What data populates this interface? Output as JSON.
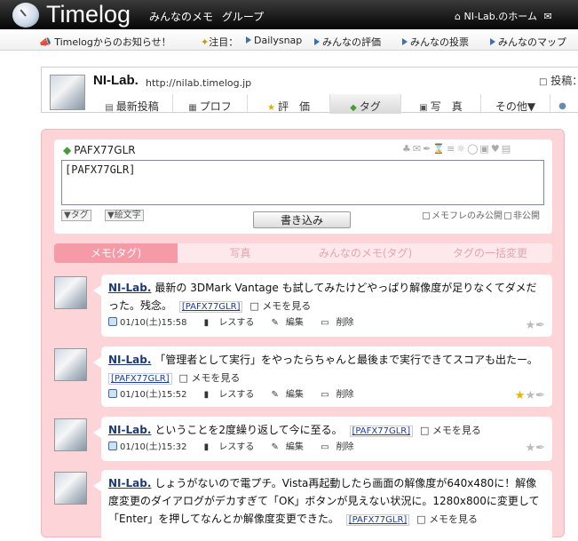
{
  "header": {
    "logo": "Timelog",
    "nav": [
      "みんなのメモ",
      "グループ"
    ],
    "home_link": "NI-Lab.のホーム",
    "mail_icon": "envelope-icon"
  },
  "notice": {
    "announcement": "Timelogからのお知らせ！",
    "attention_label": "注目：",
    "links": [
      "Dailysnap",
      "みんなの評価",
      "みんなの投票",
      "みんなのマップ"
    ]
  },
  "profile": {
    "name": "NI-Lab.",
    "url": "http://nilab.timelog.jp",
    "post_label": "投稿：",
    "tabs": [
      {
        "label": "最新投稿",
        "icon": "speech-icon"
      },
      {
        "label": "プロフ",
        "icon": "card-icon"
      },
      {
        "label": "評　価",
        "icon": "star-icon"
      },
      {
        "label": "タグ",
        "icon": "tag-icon"
      },
      {
        "label": "写　真",
        "icon": "camera-icon"
      },
      {
        "label": "その他▼",
        "icon": ""
      }
    ]
  },
  "composer": {
    "tag_title": "PAFX77GLR",
    "textarea_value": "[PAFX77GLR]",
    "tag_select": "▼タグ",
    "emoji_select": "▼絵文字",
    "submit": "書き込み",
    "checkbox_friends": "メモフレのみ公開",
    "checkbox_private": "非公開"
  },
  "subtabs": [
    "メモ(タグ)",
    "写真",
    "みんなのメモ(タグ)",
    "タグの一括変更"
  ],
  "memos": [
    {
      "author": "NI-Lab.",
      "text": "最新の 3DMark Vantage も試してみたけどやっぱり解像度が足りなくてダメだった。残念。",
      "tag": "[PAFX77GLR]",
      "see": "メモを見る",
      "time": "01/10(土)15:58",
      "reply": "レスする",
      "edit": "編集",
      "delete": "削除"
    },
    {
      "author": "NI-Lab.",
      "text": "「管理者として実行」をやったらちゃんと最後まで実行できてスコアも出たー。",
      "tag": "[PAFX77GLR]",
      "see": "メモを見る",
      "time": "01/10(土)15:52",
      "reply": "レスする",
      "edit": "編集",
      "delete": "削除"
    },
    {
      "author": "NI-Lab.",
      "text": "ということを2度繰り返して今に至る。",
      "tag": "[PAFX77GLR]",
      "see": "メモを見る",
      "time": "01/10(土)15:32",
      "reply": "レスする",
      "edit": "編集",
      "delete": "削除"
    },
    {
      "author": "NI-Lab.",
      "text": "しょうがないので電プチ。Vista再起動したら画面の解像度が640x480に！解像度変更のダイアログがデカすぎて「OK」ボタンが見えない状況に。1280x800に変更して「Enter」を押してなんとか解像度変更できた。",
      "tag": "[PAFX77GLR]",
      "see": "メモを見る"
    }
  ]
}
